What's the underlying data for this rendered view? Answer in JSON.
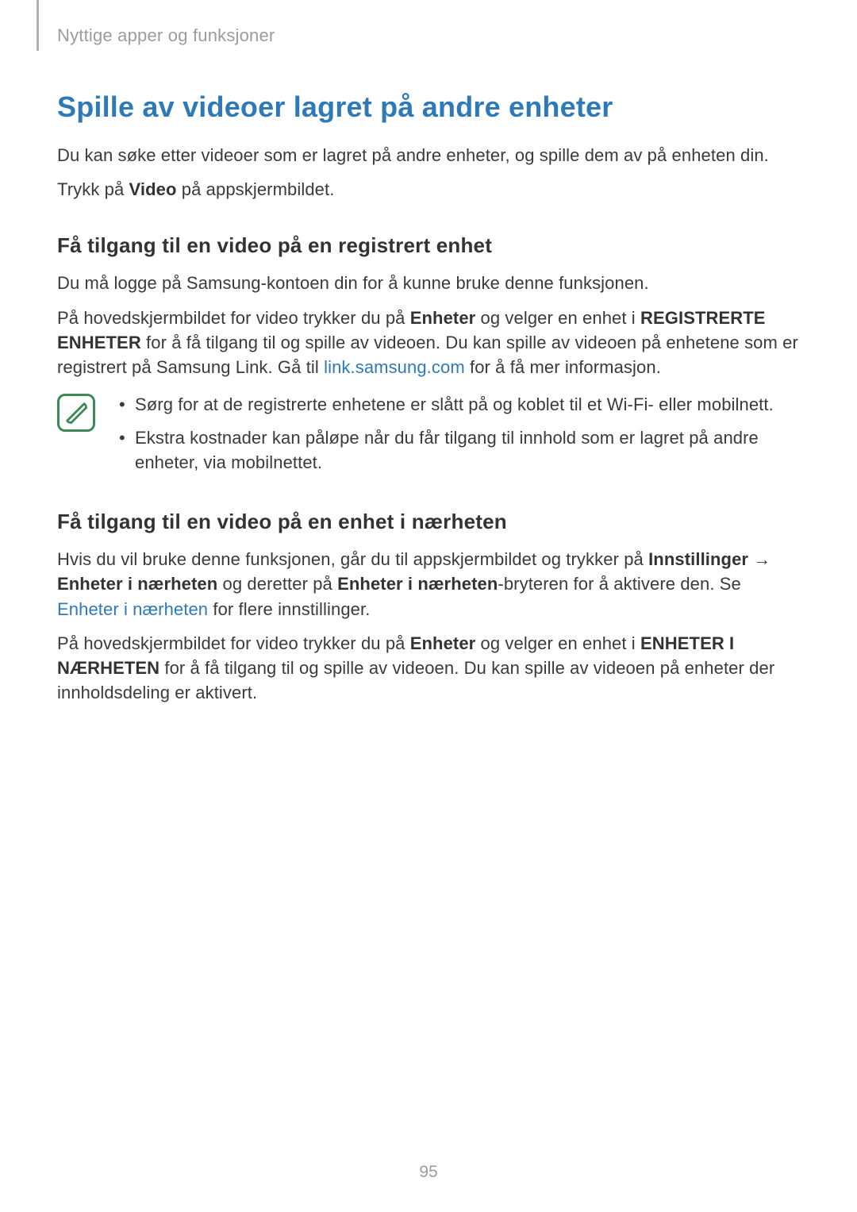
{
  "breadcrumb": "Nyttige apper og funksjoner",
  "section": {
    "title": "Spille av videoer lagret på andre enheter",
    "intro1": "Du kan søke etter videoer som er lagret på andre enheter, og spille dem av på enheten din.",
    "intro2_a": "Trykk på ",
    "intro2_b": "Video",
    "intro2_c": " på appskjermbildet."
  },
  "sub1": {
    "title": "Få tilgang til en video på en registrert enhet",
    "p1": "Du må logge på Samsung-kontoen din for å kunne bruke denne funksjonen.",
    "p2_a": "På hovedskjermbildet for video trykker du på ",
    "p2_b": "Enheter",
    "p2_c": " og velger en enhet i ",
    "p2_d": "REGISTRERTE ENHETER",
    "p2_e": " for å få tilgang til og spille av videoen. Du kan spille av videoen på enhetene som er registrert på Samsung Link. Gå til ",
    "p2_link": "link.samsung.com",
    "p2_f": " for å få mer informasjon.",
    "notes": [
      "Sørg for at de registrerte enhetene er slått på og koblet til et Wi-Fi- eller mobilnett.",
      "Ekstra kostnader kan påløpe når du får tilgang til innhold som er lagret på andre enheter, via mobilnettet."
    ]
  },
  "sub2": {
    "title": "Få tilgang til en video på en enhet i nærheten",
    "p1_a": "Hvis du vil bruke denne funksjonen, går du til appskjermbildet og trykker på ",
    "p1_b": "Innstillinger",
    "p1_arrow": " → ",
    "p1_c": "Enheter i nærheten",
    "p1_d": " og deretter på ",
    "p1_e": "Enheter i nærheten",
    "p1_f": "-bryteren for å aktivere den. Se ",
    "p1_link": "Enheter i nærheten",
    "p1_g": " for flere innstillinger.",
    "p2_a": "På hovedskjermbildet for video trykker du på ",
    "p2_b": "Enheter",
    "p2_c": " og velger en enhet i ",
    "p2_d": "ENHETER I NÆRHETEN",
    "p2_e": " for å få tilgang til og spille av videoen. Du kan spille av videoen på enheter der innholdsdeling er aktivert."
  },
  "page_number": "95"
}
